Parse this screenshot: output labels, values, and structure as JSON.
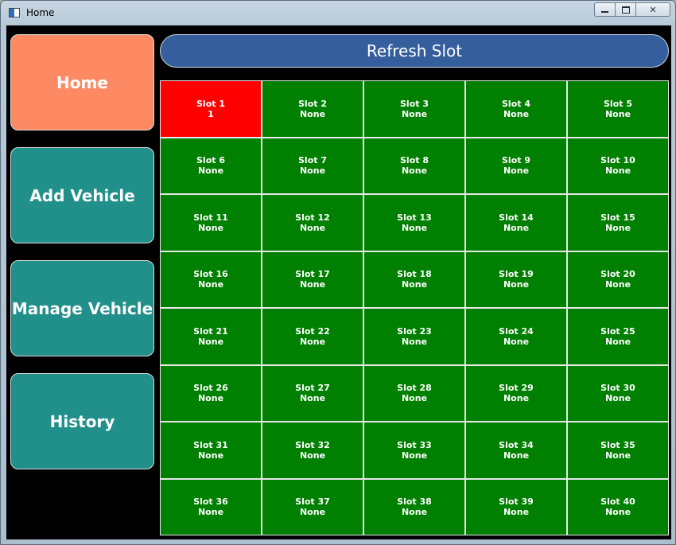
{
  "window": {
    "title": "Home"
  },
  "nav": {
    "home": "Home",
    "add_vehicle": "Add Vehicle",
    "manage_vehicle": "Manage Vehicle",
    "history": "History"
  },
  "refresh_label": "Refresh Slot",
  "colors": {
    "home_button": "#fd8a63",
    "nav_button": "#21908a",
    "refresh_button": "#355f9c",
    "slot_free": "#008000",
    "slot_occupied": "#ff0000",
    "background": "#000000"
  },
  "slots": [
    {
      "label": "Slot 1",
      "value": "1",
      "occupied": true
    },
    {
      "label": "Slot 2",
      "value": "None",
      "occupied": false
    },
    {
      "label": "Slot 3",
      "value": "None",
      "occupied": false
    },
    {
      "label": "Slot 4",
      "value": "None",
      "occupied": false
    },
    {
      "label": "Slot 5",
      "value": "None",
      "occupied": false
    },
    {
      "label": "Slot 6",
      "value": "None",
      "occupied": false
    },
    {
      "label": "Slot 7",
      "value": "None",
      "occupied": false
    },
    {
      "label": "Slot 8",
      "value": "None",
      "occupied": false
    },
    {
      "label": "Slot 9",
      "value": "None",
      "occupied": false
    },
    {
      "label": "Slot 10",
      "value": "None",
      "occupied": false
    },
    {
      "label": "Slot 11",
      "value": "None",
      "occupied": false
    },
    {
      "label": "Slot 12",
      "value": "None",
      "occupied": false
    },
    {
      "label": "Slot 13",
      "value": "None",
      "occupied": false
    },
    {
      "label": "Slot 14",
      "value": "None",
      "occupied": false
    },
    {
      "label": "Slot 15",
      "value": "None",
      "occupied": false
    },
    {
      "label": "Slot 16",
      "value": "None",
      "occupied": false
    },
    {
      "label": "Slot 17",
      "value": "None",
      "occupied": false
    },
    {
      "label": "Slot 18",
      "value": "None",
      "occupied": false
    },
    {
      "label": "Slot 19",
      "value": "None",
      "occupied": false
    },
    {
      "label": "Slot 20",
      "value": "None",
      "occupied": false
    },
    {
      "label": "Slot 21",
      "value": "None",
      "occupied": false
    },
    {
      "label": "Slot 22",
      "value": "None",
      "occupied": false
    },
    {
      "label": "Slot 23",
      "value": "None",
      "occupied": false
    },
    {
      "label": "Slot 24",
      "value": "None",
      "occupied": false
    },
    {
      "label": "Slot 25",
      "value": "None",
      "occupied": false
    },
    {
      "label": "Slot 26",
      "value": "None",
      "occupied": false
    },
    {
      "label": "Slot 27",
      "value": "None",
      "occupied": false
    },
    {
      "label": "Slot 28",
      "value": "None",
      "occupied": false
    },
    {
      "label": "Slot 29",
      "value": "None",
      "occupied": false
    },
    {
      "label": "Slot 30",
      "value": "None",
      "occupied": false
    },
    {
      "label": "Slot 31",
      "value": "None",
      "occupied": false
    },
    {
      "label": "Slot 32",
      "value": "None",
      "occupied": false
    },
    {
      "label": "Slot 33",
      "value": "None",
      "occupied": false
    },
    {
      "label": "Slot 34",
      "value": "None",
      "occupied": false
    },
    {
      "label": "Slot 35",
      "value": "None",
      "occupied": false
    },
    {
      "label": "Slot 36",
      "value": "None",
      "occupied": false
    },
    {
      "label": "Slot 37",
      "value": "None",
      "occupied": false
    },
    {
      "label": "Slot 38",
      "value": "None",
      "occupied": false
    },
    {
      "label": "Slot 39",
      "value": "None",
      "occupied": false
    },
    {
      "label": "Slot 40",
      "value": "None",
      "occupied": false
    }
  ]
}
